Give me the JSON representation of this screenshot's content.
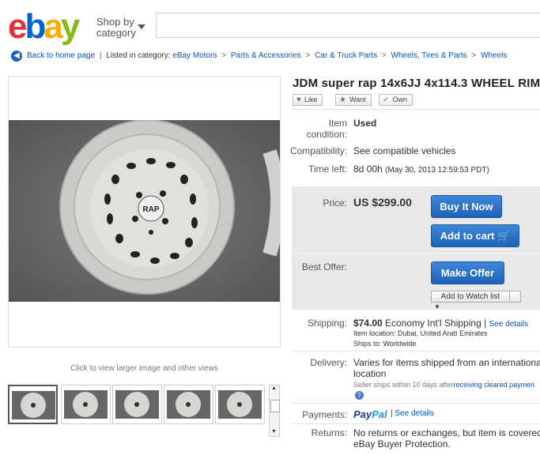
{
  "header": {
    "logo_letters": [
      "e",
      "b",
      "a",
      "y"
    ],
    "logo_colors": [
      "#e53238",
      "#0064d2",
      "#f5af02",
      "#86b817"
    ],
    "shop_by_line1": "Shop by",
    "shop_by_line2": "category",
    "search_value": ""
  },
  "breadcrumb": {
    "back_label": "Back to home page",
    "listed_in": "Listed in category:",
    "items": [
      "eBay Motors",
      "Parts & Accessories",
      "Car & Truck Parts",
      "Wheels, Tires & Parts",
      "Wheels"
    ],
    "separator": ">"
  },
  "gallery": {
    "caption": "Click to view larger image and other views",
    "thumbnail_count": 5
  },
  "item": {
    "title": "JDM super rap 14x6JJ 4x114.3 WHEEL RIM",
    "like": "Like",
    "want": "Want",
    "own": "Own",
    "condition_label_1": "Item",
    "condition_label_2": "condition:",
    "condition_value": "Used",
    "compat_label": "Compatibility:",
    "compat_link": "See compatible vehicles",
    "time_label": "Time left:",
    "time_value": "8d 00h",
    "time_end": "(May 30, 2013  12:59:53 PDT)"
  },
  "purchase": {
    "price_label": "Price:",
    "price_value": "US $299.00",
    "buy_now": "Buy It Now",
    "add_to_cart": "Add to cart",
    "best_offer_label": "Best Offer:",
    "make_offer": "Make Offer",
    "watch_list": "Add to Watch list",
    "accent_color": "#1e63b8"
  },
  "shipping": {
    "label": "Shipping:",
    "cost": "$74.00",
    "service": "Economy Int'l Shipping |",
    "details_link": "See details",
    "location": "Item location:  Dubai, United Arab Emirates",
    "ships_to": "Ships to:  Worldwide"
  },
  "delivery": {
    "label": "Delivery:",
    "line1": "Varies for items shipped from an international",
    "line2": "location",
    "note_prefix": "Seller ships within 10 days after",
    "note_link": "receiving cleared paymen"
  },
  "payments": {
    "label": "Payments:",
    "paypal_pay": "Pay",
    "paypal_pal": "Pal",
    "details_link": "See details"
  },
  "returns": {
    "label": "Returns:",
    "line1": "No returns or exchanges, but item is covered by",
    "line2": "eBay Buyer Protection."
  }
}
